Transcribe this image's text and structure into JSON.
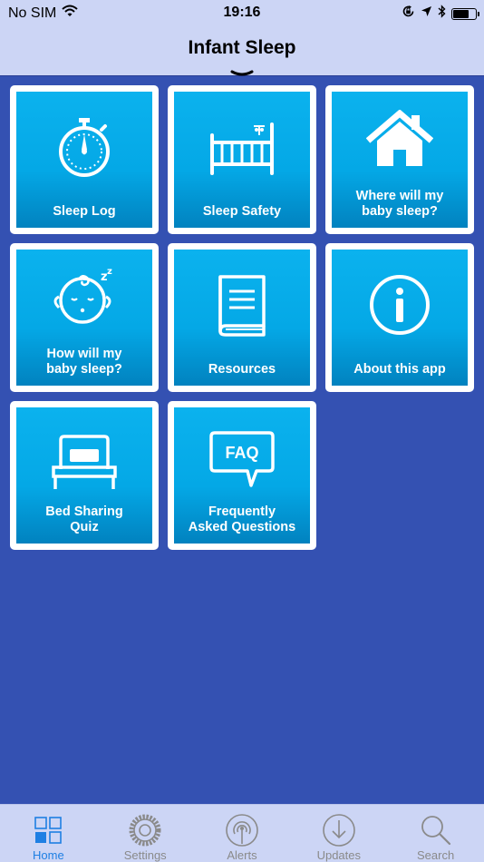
{
  "status_bar": {
    "carrier": "No SIM",
    "time": "19:16",
    "battery_level": 0.72
  },
  "header": {
    "title": "Infant Sleep"
  },
  "tiles": [
    {
      "label": "Sleep Log",
      "icon": "stopwatch-icon"
    },
    {
      "label": "Sleep Safety",
      "icon": "crib-icon"
    },
    {
      "label": "Where will my\nbaby sleep?",
      "icon": "house-icon"
    },
    {
      "label": "How will my\nbaby sleep?",
      "icon": "sleeping-baby-icon"
    },
    {
      "label": "Resources",
      "icon": "book-icon"
    },
    {
      "label": "About this app",
      "icon": "info-icon"
    },
    {
      "label": "Bed Sharing\nQuiz",
      "icon": "bed-icon"
    },
    {
      "label": "Frequently\nAsked Questions",
      "icon": "faq-bubble-icon",
      "icon_text": "FAQ"
    }
  ],
  "tabbar": {
    "tabs": [
      {
        "label": "Home",
        "icon": "home-grid-icon",
        "active": true
      },
      {
        "label": "Settings",
        "icon": "gear-icon",
        "active": false
      },
      {
        "label": "Alerts",
        "icon": "broadcast-icon",
        "active": false
      },
      {
        "label": "Updates",
        "icon": "download-icon",
        "active": false
      },
      {
        "label": "Search",
        "icon": "search-icon",
        "active": false
      }
    ]
  },
  "colors": {
    "background": "#3451b2",
    "header": "#ccd5f5",
    "tile_top": "#0bb2ee",
    "tile_bottom": "#0182bf",
    "tab_active": "#1e7fe3",
    "tab_inactive": "#8a8a8a"
  }
}
